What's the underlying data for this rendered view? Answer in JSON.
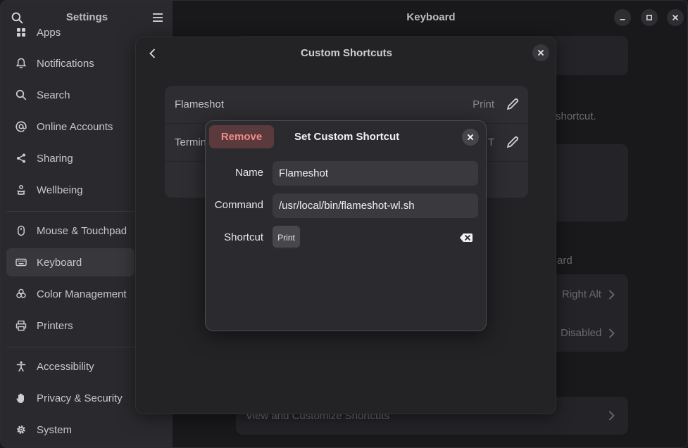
{
  "sidebar": {
    "title": "Settings",
    "items": [
      {
        "label": "Apps",
        "icon": "apps-icon"
      },
      {
        "label": "Notifications",
        "icon": "bell-icon"
      },
      {
        "label": "Search",
        "icon": "search-icon"
      },
      {
        "label": "Online Accounts",
        "icon": "at-sign-icon"
      },
      {
        "label": "Sharing",
        "icon": "share-icon"
      },
      {
        "label": "Wellbeing",
        "icon": "wellbeing-icon"
      },
      {
        "label": "Mouse & Touchpad",
        "icon": "mouse-icon"
      },
      {
        "label": "Keyboard",
        "icon": "keyboard-icon",
        "active": true
      },
      {
        "label": "Color Management",
        "icon": "palette-icon"
      },
      {
        "label": "Printers",
        "icon": "printer-icon"
      },
      {
        "label": "Accessibility",
        "icon": "accessibility-icon"
      },
      {
        "label": "Privacy & Security",
        "icon": "hand-icon"
      },
      {
        "label": "System",
        "icon": "gear-icon"
      }
    ]
  },
  "main": {
    "title": "Keyboard",
    "bg_text": {
      "shortcut_hint": "shortcut.",
      "keyboard_hint": "ard",
      "alt_value": "Right Alt",
      "disabled_value": "Disabled",
      "view_shortcuts": "View and Customize Shortcuts"
    }
  },
  "custom_shortcuts_dialog": {
    "title": "Custom Shortcuts",
    "rows": [
      {
        "name": "Flameshot",
        "key": "Print"
      },
      {
        "name": "Termin",
        "key": "T"
      }
    ]
  },
  "set_shortcut_dialog": {
    "title": "Set Custom Shortcut",
    "remove_label": "Remove",
    "name_label": "Name",
    "name_value": "Flameshot",
    "command_label": "Command",
    "command_value": "/usr/local/bin/flameshot-wl.sh",
    "shortcut_label": "Shortcut",
    "shortcut_key": "Print"
  },
  "colors": {
    "accent_destructive": "#f08b87",
    "active_item_bg": "#38383c"
  }
}
